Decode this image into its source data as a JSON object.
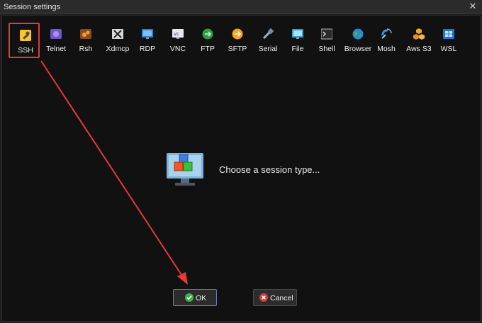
{
  "window": {
    "title": "Session settings",
    "close_glyph": "✕"
  },
  "toolbar": {
    "items": [
      {
        "label": "SSH",
        "icon": "wrench-icon",
        "selected": true
      },
      {
        "label": "Telnet",
        "icon": "telnet-icon"
      },
      {
        "label": "Rsh",
        "icon": "rsh-icon"
      },
      {
        "label": "Xdmcp",
        "icon": "xdmcp-icon"
      },
      {
        "label": "RDP",
        "icon": "rdp-icon"
      },
      {
        "label": "VNC",
        "icon": "vnc-icon"
      },
      {
        "label": "FTP",
        "icon": "ftp-icon"
      },
      {
        "label": "SFTP",
        "icon": "sftp-icon"
      },
      {
        "label": "Serial",
        "icon": "serial-icon"
      },
      {
        "label": "File",
        "icon": "file-icon"
      },
      {
        "label": "Shell",
        "icon": "shell-icon"
      },
      {
        "label": "Browser",
        "icon": "globe-icon"
      },
      {
        "label": "Mosh",
        "icon": "mosh-icon"
      },
      {
        "label": "Aws S3",
        "icon": "aws-s3-icon"
      },
      {
        "label": "WSL",
        "icon": "windows-icon"
      }
    ]
  },
  "main": {
    "prompt": "Choose a session type..."
  },
  "buttons": {
    "ok": "OK",
    "cancel": "Cancel"
  },
  "colors": {
    "highlight": "#e53935",
    "background": "#111111"
  }
}
